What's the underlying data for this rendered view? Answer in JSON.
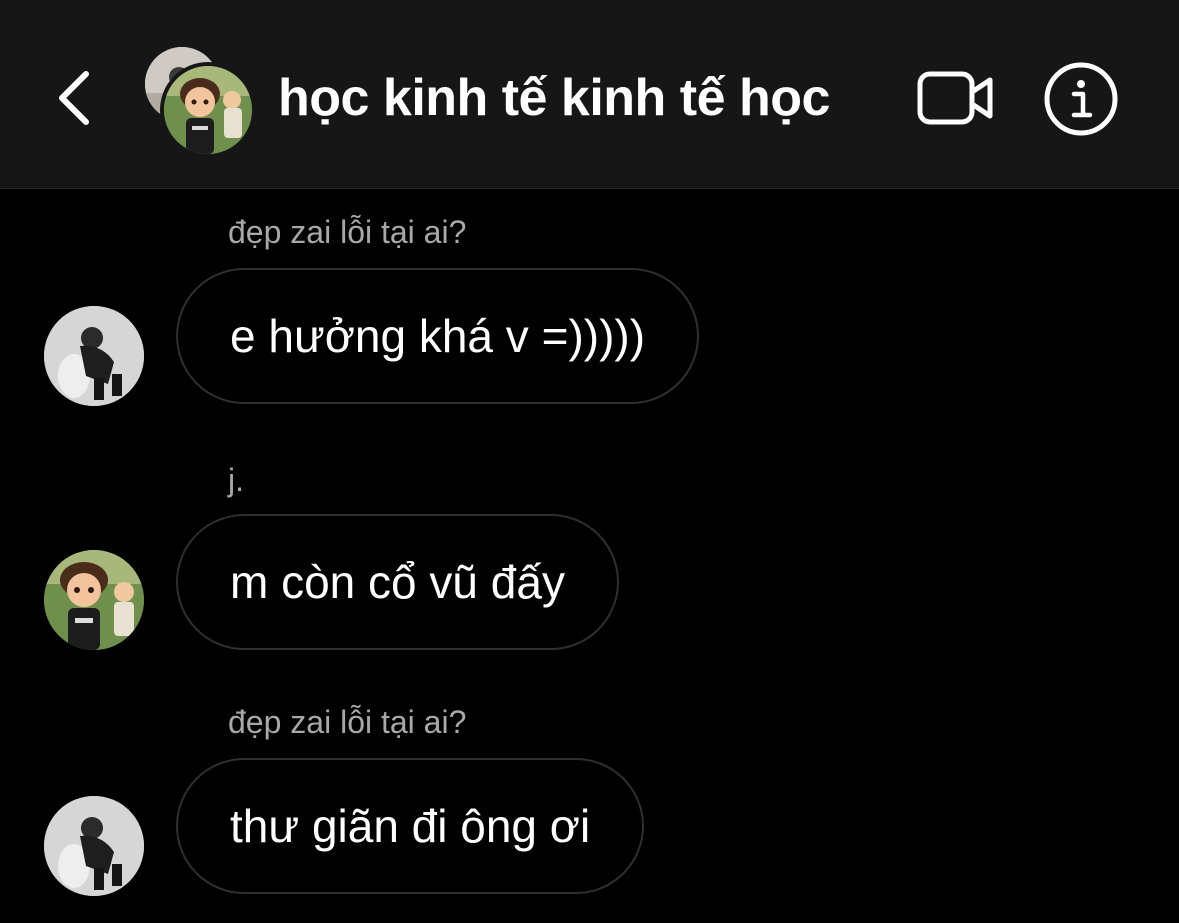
{
  "header": {
    "title": "học kinh tế kinh tế học",
    "back_icon": "chevron-left-icon",
    "video_icon": "video-camera-icon",
    "info_icon": "info-icon"
  },
  "messages": [
    {
      "sender": "đẹp zai lỗi tại ai?",
      "text": "e hưởng khá v =)))))",
      "avatar": "bw-photo"
    },
    {
      "sender": "j.",
      "text": "m còn cổ vũ đấy",
      "avatar": "cartoon-photo"
    },
    {
      "sender": "đẹp zai lỗi tại ai?",
      "text": "thư giãn đi ông ơi",
      "avatar": "bw-photo"
    }
  ],
  "colors": {
    "header_bg": "#161616",
    "background": "#000000",
    "bubble_border": "#2f2f2f",
    "sender_text": "#a8a8a8",
    "text": "#ffffff"
  }
}
